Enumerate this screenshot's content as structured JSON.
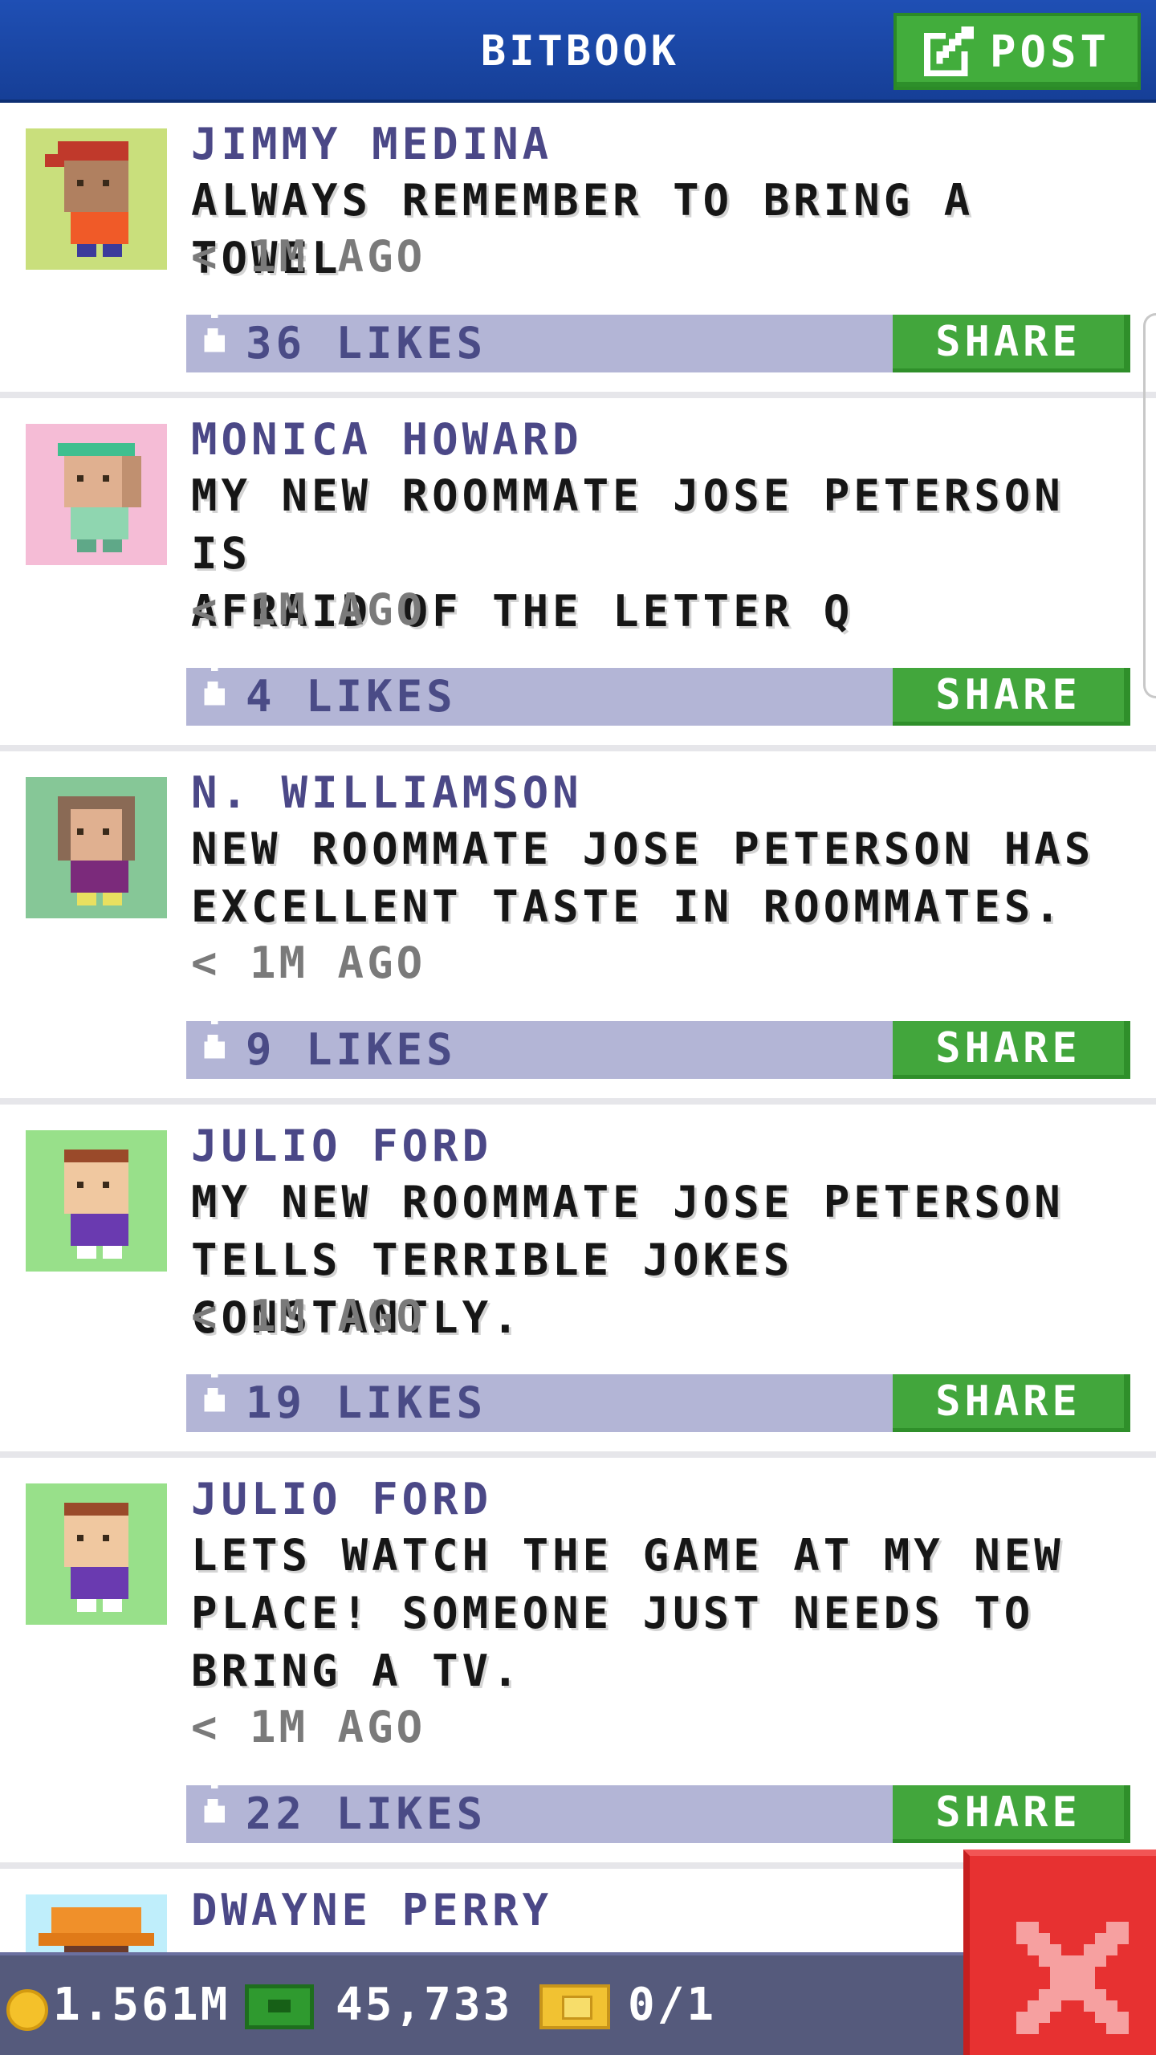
{
  "header": {
    "title": "BITBOOK",
    "post_label": "POST"
  },
  "posts": [
    {
      "name": "JIMMY MEDINA",
      "lines": [
        "ALWAYS REMEMBER TO BRING A TOWEL"
      ],
      "time": "< 1M AGO",
      "likes": "36 LIKES",
      "share": "SHARE",
      "avatar_bg": "#c9df7c"
    },
    {
      "name": "MONICA HOWARD",
      "lines": [
        "MY NEW ROOMMATE JOSE PETERSON IS",
        "AFRAID OF THE LETTER Q"
      ],
      "time": "< 1M AGO",
      "likes": "4 LIKES",
      "share": "SHARE",
      "avatar_bg": "#f5bcd6"
    },
    {
      "name": "N. WILLIAMSON",
      "lines": [
        "NEW ROOMMATE JOSE PETERSON HAS",
        "EXCELLENT TASTE IN ROOMMATES."
      ],
      "time": "< 1M AGO",
      "likes": "9 LIKES",
      "share": "SHARE",
      "avatar_bg": "#86c797"
    },
    {
      "name": "JULIO FORD",
      "lines": [
        "MY NEW ROOMMATE JOSE PETERSON",
        "TELLS TERRIBLE JOKES CONSTANTLY."
      ],
      "time": "< 1M AGO",
      "likes": "19 LIKES",
      "share": "SHARE",
      "avatar_bg": "#98e08a"
    },
    {
      "name": "JULIO FORD",
      "lines": [
        "LETS WATCH THE GAME AT MY NEW",
        "PLACE! SOMEONE JUST NEEDS TO",
        "BRING A TV."
      ],
      "time": "< 1M AGO",
      "likes": "22 LIKES",
      "share": "SHARE",
      "avatar_bg": "#98e08a"
    },
    {
      "name": "DWAYNE PERRY",
      "avatar_bg": "#bfeefb"
    }
  ],
  "status_bar": {
    "coins": "1.561M",
    "bux": "45,733",
    "tickets": "0/1"
  },
  "colors": {
    "header_blue": "#1f4fb4",
    "button_green": "#42a63c",
    "likes_bar": "#b3b5d6",
    "name_purple": "#4b4887",
    "close_red": "#e73131"
  },
  "icons": [
    "pencil-icon",
    "thumbs-up-icon",
    "coin-icon",
    "cash-icon",
    "ticket-icon",
    "close-x-icon"
  ]
}
